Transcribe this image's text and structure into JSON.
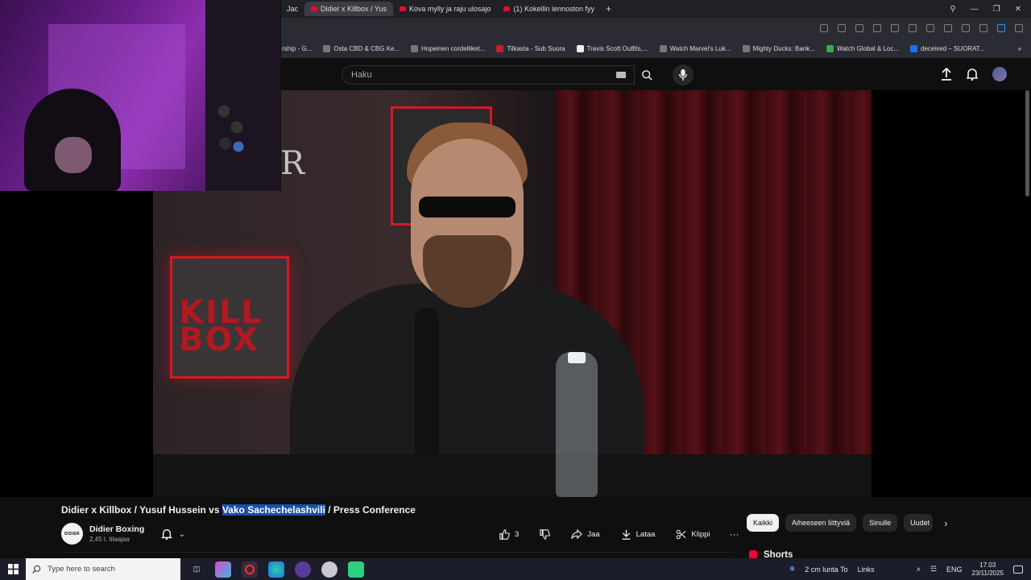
{
  "browser": {
    "tabs": [
      {
        "label": "Jac",
        "active": false
      },
      {
        "label": "Didier x Killbox / Yus",
        "active": true
      },
      {
        "label": "Kova mylly ja raju ulosajo",
        "active": false
      },
      {
        "label": "(1) Kokeilin lennoston fyy",
        "active": false
      }
    ],
    "new_tab": "+",
    "bookmarks": [
      "rship - G...",
      "Osta CBD & CBG Ke...",
      "Hopeinen cordelliket...",
      "Tilkasta - Sub Suora",
      "Travis Scott Outfits,...",
      "Watch Marvel's Luk...",
      "Mighty Ducks: Bank...",
      "Watch Global & Loc...",
      "deceived – SUORAT..."
    ]
  },
  "youtube": {
    "search_placeholder": "Haku",
    "video": {
      "title_before": "Didier x Killbox / Yusuf Hussein vs ",
      "title_highlight": "Vako Sachechelashvili",
      "title_after": " / Press Conference",
      "poster_text": "KILL BOX",
      "side_letter": "R"
    },
    "channel": {
      "avatar_text": "DIDIER",
      "name": "Didier Boxing",
      "subscribers": "2,45 t. tilaajaa"
    },
    "actions": {
      "like_count": "3",
      "share": "Jaa",
      "download": "Lataa",
      "clip": "Klippi",
      "more": "···"
    },
    "chips": [
      "Kaikki",
      "Aiheeseen liittyviä",
      "Sinulle",
      "Uudet"
    ],
    "shorts_label": "Shorts"
  },
  "taskbar": {
    "search_placeholder": "Type here to search",
    "weather": "2 cm lunta To",
    "links": "Links",
    "language": "ENG",
    "time": "17.03",
    "date": "23/11/2025"
  },
  "colors": {
    "accent_red": "#ff0033",
    "highlight": "#1b4fa8",
    "background": "#0f0f0f"
  }
}
